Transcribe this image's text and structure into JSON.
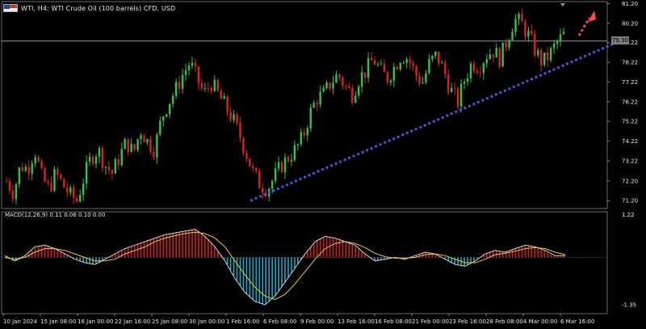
{
  "header": {
    "symbol_text": "WTI, H4:  WTI Crude Oil (100 barrels) CFD, USD",
    "current_price_tag": "79.30"
  },
  "indicator": {
    "macd_label": "MACD(12,26,9) 0.11 0.06 0.10 0.00"
  },
  "colors": {
    "background": "#000000",
    "bull_candle": "#2fc83a",
    "bear_candle": "#e0201c",
    "grid": "#3a3a3a",
    "axis_text": "#e8e8e8",
    "trendline": "#4a55e0",
    "arrow": "#ff4a4a",
    "macd_pos_hist": "#d02020",
    "macd_neg_hist": "#20a8c8",
    "macd_line": "#d0d0d0",
    "signal_line": "#e8d020",
    "price_line": "#9a9a9a",
    "close_marker": "#8a8a8a"
  },
  "chart_data": {
    "type": "candlestick",
    "price_axis_ticks": [
      "81.20",
      "80.20",
      "79.22",
      "78.22",
      "77.22",
      "76.22",
      "75.22",
      "74.22",
      "73.22",
      "72.20",
      "71.20"
    ],
    "price_ylim": [
      70.8,
      81.3
    ],
    "macd_axis_ticks": [
      "1.22",
      "-1.35"
    ],
    "macd_ylim": [
      -1.6,
      1.3
    ],
    "time_axis_labels": [
      "10 Jan 2024",
      "15 Jan 08:00",
      "18 Jan 00:00",
      "22 Jan 16:00",
      "25 Jan 08:00",
      "30 Jan 00:00",
      "1 Feb 16:00",
      "6 Feb 08:00",
      "9 Feb 00:00",
      "13 Feb 16:00",
      "16 Feb 08:00",
      "21 Feb 00:00",
      "23 Feb 16:00",
      "28 Feb 08:00",
      "4 Mar 00:00",
      "6 Mar 16:00"
    ],
    "current_price": 79.3,
    "close_path": [
      72.2,
      71.6,
      73.0,
      72.8,
      73.8,
      72.4,
      71.8,
      72.6,
      72.0,
      71.5,
      71.2,
      72.4,
      73.4,
      73.8,
      73.0,
      72.6,
      73.4,
      74.2,
      73.6,
      74.8,
      74.2,
      73.8,
      75.4,
      76.2,
      76.8,
      77.6,
      78.2,
      77.4,
      76.6,
      77.2,
      76.6,
      76.0,
      75.4,
      74.6,
      73.6,
      72.6,
      72.0,
      71.8,
      72.4,
      73.0,
      73.4,
      73.8,
      74.4,
      75.6,
      76.4,
      76.6,
      77.2,
      77.6,
      77.0,
      76.6,
      77.4,
      77.8,
      78.4,
      77.8,
      77.4,
      78.0,
      78.6,
      78.4,
      77.6,
      77.2,
      78.2,
      78.6,
      77.8,
      76.8,
      76.2,
      77.4,
      78.2,
      78.0,
      78.6,
      78.8,
      78.4,
      79.4,
      80.4,
      80.2,
      79.6,
      78.8,
      78.2,
      78.6,
      79.2,
      79.6
    ],
    "trendline": {
      "from": {
        "x": "1 Feb 16:00",
        "y": 71.2
      },
      "to": {
        "x": "6 Mar 16:00",
        "y": 79.2
      }
    },
    "series": [
      {
        "values": [
          0.05,
          -0.1,
          0.05,
          0.3,
          0.35,
          0.25,
          0.1,
          -0.05,
          -0.15,
          -0.2,
          -0.05,
          0.1,
          0.25,
          0.35,
          0.45,
          0.55,
          0.65,
          0.7,
          0.75,
          0.8,
          0.6,
          0.3,
          -0.1,
          -0.6,
          -1.0,
          -1.25,
          -1.35,
          -1.1,
          -0.7,
          -0.3,
          0.1,
          0.45,
          0.6,
          0.55,
          0.45,
          0.35,
          0.1,
          -0.1,
          -0.05,
          0.0,
          -0.05,
          0.05,
          0.15,
          0.1,
          -0.05,
          -0.2,
          -0.25,
          -0.1,
          0.1,
          0.2,
          0.15,
          0.25,
          0.35,
          0.3,
          0.2,
          0.05,
          0.05
        ]
      },
      {
        "values": [
          0.0,
          -0.05,
          0.0,
          0.15,
          0.25,
          0.25,
          0.2,
          0.1,
          0.0,
          -0.1,
          -0.1,
          -0.05,
          0.1,
          0.2,
          0.3,
          0.45,
          0.55,
          0.62,
          0.68,
          0.72,
          0.68,
          0.55,
          0.3,
          -0.1,
          -0.5,
          -0.85,
          -1.1,
          -1.2,
          -1.05,
          -0.75,
          -0.4,
          -0.05,
          0.25,
          0.4,
          0.45,
          0.4,
          0.28,
          0.12,
          0.02,
          -0.02,
          -0.02,
          0.0,
          0.08,
          0.1,
          0.05,
          -0.05,
          -0.15,
          -0.15,
          -0.05,
          0.08,
          0.12,
          0.18,
          0.25,
          0.28,
          0.25,
          0.15,
          0.08
        ]
      }
    ]
  }
}
